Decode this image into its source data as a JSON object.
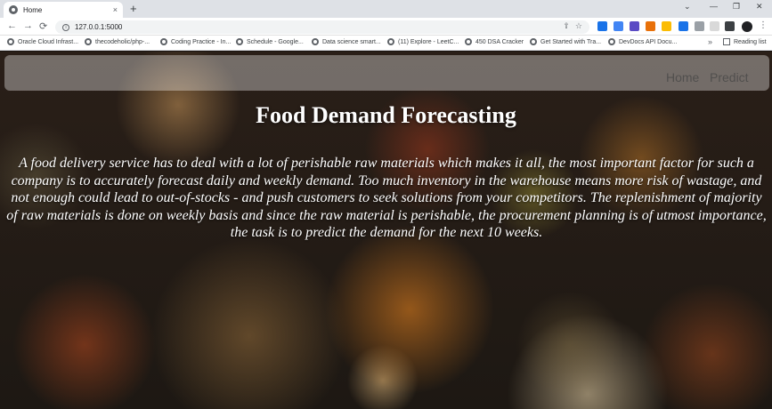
{
  "browser": {
    "tab": {
      "title": "Home",
      "close_label": "×",
      "new_tab_label": "+"
    },
    "window_controls": {
      "minimize": "—",
      "restore": "❐",
      "close": "✕",
      "collapse": "⌄"
    },
    "nav": {
      "back": "←",
      "forward": "→",
      "reload": "⟳"
    },
    "address": {
      "url": "127.0.0.1:5000"
    },
    "bookmarks": [
      "Oracle Cloud Infrast...",
      "thecodeholic/php-...",
      "Coding Practice - In...",
      "Schedule - Google...",
      "Data science smart...",
      "(11) Explore - LeetC...",
      "450 DSA Cracker",
      "Get Started with Tra...",
      "DevDocs API Docu..."
    ],
    "bookmarks_more": "»",
    "reading_list": "Reading list"
  },
  "site": {
    "nav": {
      "home": "Home",
      "predict": "Predict"
    },
    "title": "Food Demand Forecasting",
    "description": "A food delivery service has to deal with a lot of perishable raw materials which makes it all, the most important factor for such a company is to accurately forecast daily and weekly demand. Too much inventory in the warehouse means more risk of wastage, and not enough could lead to out-of-stocks - and push customers to seek solutions from your competitors. The replenishment of majority of raw materials is done on weekly basis and since the raw material is perishable, the procurement planning is of utmost importance, the task is to predict the demand for the next 10 weeks."
  }
}
